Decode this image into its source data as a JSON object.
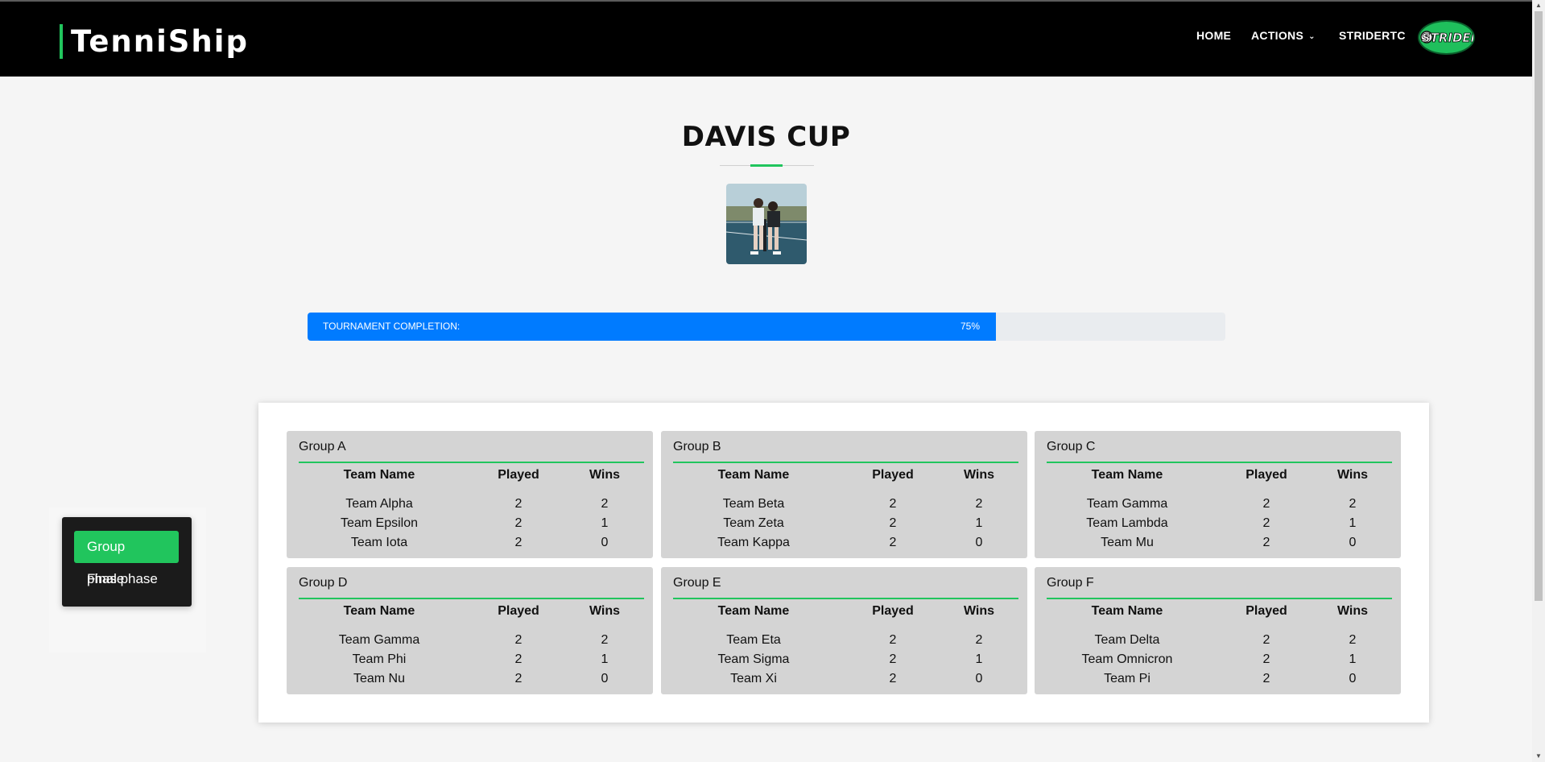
{
  "header": {
    "brand": "TenniShip",
    "nav": {
      "home": "HOME",
      "actions": "ACTIONS",
      "actions_chevron": "⌄",
      "user": "STRIDERTC"
    },
    "logo_text": "STRIDER",
    "accent_color": "#21c55d"
  },
  "page": {
    "title": "DAVIS CUP",
    "photo_alt": "tournament-photo"
  },
  "progress": {
    "label": "TOURNAMENT COMPLETION:",
    "percent_text": "75%",
    "value": 0.75,
    "fill_color": "#007bff"
  },
  "side_menu": {
    "items": [
      {
        "label": "Group phase",
        "active": true
      },
      {
        "label": "Final phase",
        "active": false
      }
    ]
  },
  "table_headers": {
    "team": "Team Name",
    "played": "Played",
    "wins": "Wins"
  },
  "groups": [
    {
      "name": "Group A",
      "rows": [
        {
          "team": "Team Alpha",
          "played": "2",
          "wins": "2"
        },
        {
          "team": "Team Epsilon",
          "played": "2",
          "wins": "1"
        },
        {
          "team": "Team Iota",
          "played": "2",
          "wins": "0"
        }
      ]
    },
    {
      "name": "Group B",
      "rows": [
        {
          "team": "Team Beta",
          "played": "2",
          "wins": "2"
        },
        {
          "team": "Team Zeta",
          "played": "2",
          "wins": "1"
        },
        {
          "team": "Team Kappa",
          "played": "2",
          "wins": "0"
        }
      ]
    },
    {
      "name": "Group C",
      "rows": [
        {
          "team": "Team Gamma",
          "played": "2",
          "wins": "2"
        },
        {
          "team": "Team Lambda",
          "played": "2",
          "wins": "1"
        },
        {
          "team": "Team Mu",
          "played": "2",
          "wins": "0"
        }
      ]
    },
    {
      "name": "Group D",
      "rows": [
        {
          "team": "Team Gamma",
          "played": "2",
          "wins": "2"
        },
        {
          "team": "Team Phi",
          "played": "2",
          "wins": "1"
        },
        {
          "team": "Team Nu",
          "played": "2",
          "wins": "0"
        }
      ]
    },
    {
      "name": "Group E",
      "rows": [
        {
          "team": "Team Eta",
          "played": "2",
          "wins": "2"
        },
        {
          "team": "Team Sigma",
          "played": "2",
          "wins": "1"
        },
        {
          "team": "Team Xi",
          "played": "2",
          "wins": "0"
        }
      ]
    },
    {
      "name": "Group F",
      "rows": [
        {
          "team": "Team Delta",
          "played": "2",
          "wins": "2"
        },
        {
          "team": "Team Omnicron",
          "played": "2",
          "wins": "1"
        },
        {
          "team": "Team Pi",
          "played": "2",
          "wins": "0"
        }
      ]
    }
  ]
}
